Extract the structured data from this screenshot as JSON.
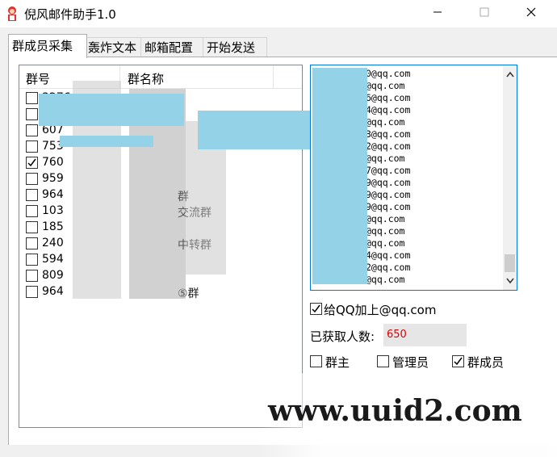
{
  "window": {
    "title": "倪风邮件助手1.0",
    "controls": {
      "minimize": "─",
      "maximize": "☐",
      "close": "✕"
    }
  },
  "tabs": [
    {
      "label": "群成员采集",
      "active": true
    },
    {
      "label": "轰炸文本",
      "active": false
    },
    {
      "label": "邮箱配置",
      "active": false
    },
    {
      "label": "开始发送",
      "active": false
    }
  ],
  "group_list": {
    "columns": [
      "群号",
      "群名称"
    ],
    "rows": [
      {
        "num": "3276",
        "name": "",
        "checked": false
      },
      {
        "num": "",
        "name": "",
        "checked": false
      },
      {
        "num": "607",
        "name": "",
        "checked": false
      },
      {
        "num": "753",
        "name": "",
        "checked": false
      },
      {
        "num": "760",
        "name": "",
        "checked": true
      },
      {
        "num": "959",
        "name": "",
        "checked": false
      },
      {
        "num": "964",
        "name": "群",
        "checked": false
      },
      {
        "num": "103",
        "name": "交流群",
        "checked": false
      },
      {
        "num": "185",
        "name": "",
        "checked": false
      },
      {
        "num": "240",
        "name": "中转群",
        "checked": false
      },
      {
        "num": "594",
        "name": "",
        "checked": false
      },
      {
        "num": "809",
        "name": "",
        "checked": false
      },
      {
        "num": "964",
        "name": "⑤群",
        "checked": false
      }
    ]
  },
  "emails": {
    "lines": [
      "0@qq.com",
      "@qq.com",
      "6@qq.com",
      "4@qq.com",
      "@qq.com",
      "3@qq.com",
      "2@qq.com",
      "@qq.com",
      "7@qq.com",
      "9@qq.com",
      "9@qq.com",
      "9@qq.com",
      "@qq.com",
      "@qq.com",
      "@qq.com",
      "4@qq.com",
      "2@qq.com",
      "@qq.com"
    ]
  },
  "options": {
    "add_suffix": {
      "label": "给QQ加上@qq.com",
      "checked": true
    },
    "fetched_label": "已获取人数:",
    "fetched_count": "650",
    "role_owner": {
      "label": "群主",
      "checked": false
    },
    "role_admin": {
      "label": "管理员",
      "checked": false
    },
    "role_member": {
      "label": "群成员",
      "checked": true
    }
  },
  "watermark": "www.uuid2.com",
  "colors": {
    "accent": "#0078d7",
    "count_text": "#e00000",
    "redaction": "#94d3e7"
  }
}
